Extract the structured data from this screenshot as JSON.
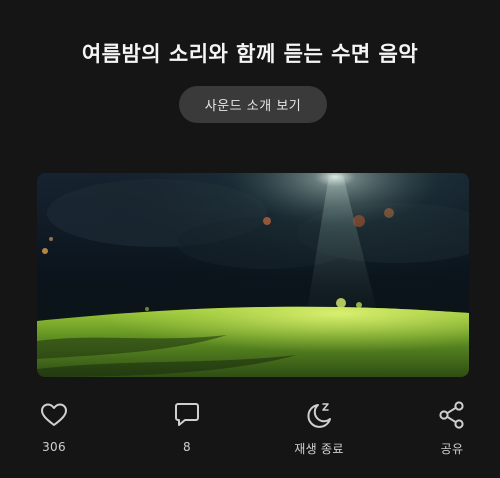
{
  "header": {
    "title": "여름밤의 소리와 함께 듣는 수면 음악",
    "intro_button_label": "사운드 소개 보기"
  },
  "artwork": {
    "icon": "night-meadow-image",
    "colors": {
      "sky": "#0d1620",
      "grass": "#b9dc45",
      "light": "#dfeee0"
    }
  },
  "actions": {
    "like": {
      "icon": "heart-icon",
      "count": "306"
    },
    "comment": {
      "icon": "comment-icon",
      "count": "8"
    },
    "sleep_timer": {
      "icon": "moon-zz-icon",
      "label": "재생 종료"
    },
    "share": {
      "icon": "share-icon",
      "label": "공유"
    }
  },
  "theme": {
    "background": "#151515",
    "button_background": "#3a3a3a",
    "icon_color": "#cfcfcf"
  }
}
